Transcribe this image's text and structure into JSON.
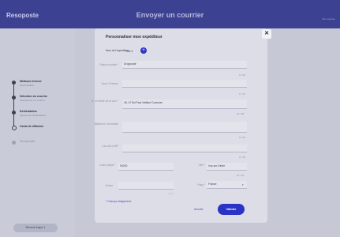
{
  "app": {
    "logo": "Resoposte",
    "title": "Envoyer un courrier",
    "header_link": "Mon espace"
  },
  "steps": [
    {
      "title": "Méthode d'envoi",
      "subtitle": "Personnaliser"
    },
    {
      "title": "Sélection du courrier",
      "subtitle": "Sélectionner un courrier"
    },
    {
      "title": "Destinataires",
      "subtitle": "Ajouter des destinataires"
    },
    {
      "title": "Canal de diffusion",
      "subtitle": ""
    },
    {
      "title": "Récapitulatif",
      "subtitle": ""
    }
  ],
  "back_button": "Revenir étape 1",
  "modal": {
    "title": "Personnaliser mon expéditeur",
    "sender_label": "Nom de l'expéditeur",
    "sender_value": "Titre",
    "fields": {
      "company": {
        "label": "Raison sociale *",
        "value": "Dropposte",
        "count": "9 / 38"
      },
      "dept": {
        "label": "Nom / Prénom",
        "value": "",
        "count": "0 / 38"
      },
      "street": {
        "label": "N° et libellé de la voie *",
        "value": "45, 47 Bd Paul Vaillant Couturier",
        "count": "33 / 38"
      },
      "building": {
        "label": "Bâtiment / Immeuble",
        "value": "",
        "count": "0 / 38"
      },
      "bp": {
        "label": "Lieu-dit ou BP",
        "value": "",
        "count": "0 / 38"
      },
      "postcode": {
        "label": "Code postal *",
        "value": "94200",
        "count": "5 / 5"
      },
      "city": {
        "label": "Ville *",
        "value": "Ivry-sur-Seine",
        "count": "14 / 32"
      },
      "cedex": {
        "label": "Cedex",
        "value": "",
        "count": "0 / 7"
      },
      "country": {
        "label": "Pays *",
        "value": "France"
      }
    },
    "required_note": "* Champs obligatoires",
    "cancel": "Annuler",
    "validate": "Valider"
  }
}
